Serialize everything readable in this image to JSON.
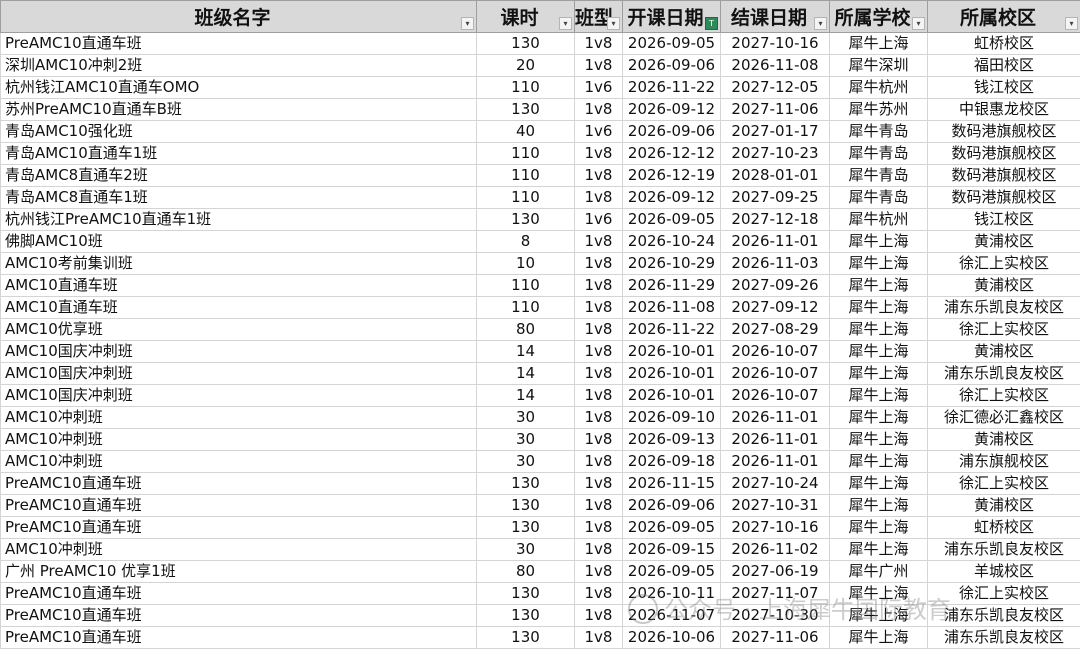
{
  "headers": [
    {
      "label": "班级名字",
      "filter_active": false
    },
    {
      "label": "课时",
      "filter_active": false
    },
    {
      "label": "班型",
      "filter_active": false
    },
    {
      "label": "开课日期",
      "filter_active": true
    },
    {
      "label": "结课日期",
      "filter_active": false
    },
    {
      "label": "所属学校",
      "filter_active": false
    },
    {
      "label": "所属校区",
      "filter_active": false
    }
  ],
  "filter_icons": {
    "inactive": "dropdown-arrow-icon",
    "active": "filter-funnel-icon"
  },
  "rows": [
    [
      "PreAMC10直通车班",
      "130",
      "1v8",
      "2026-09-05",
      "2027-10-16",
      "犀牛上海",
      "虹桥校区"
    ],
    [
      "深圳AMC10冲刺2班",
      "20",
      "1v8",
      "2026-09-06",
      "2026-11-08",
      "犀牛深圳",
      "福田校区"
    ],
    [
      "杭州钱江AMC10直通车OMO",
      "110",
      "1v6",
      "2026-11-22",
      "2027-12-05",
      "犀牛杭州",
      "钱江校区"
    ],
    [
      "苏州PreAMC10直通车B班",
      "130",
      "1v8",
      "2026-09-12",
      "2027-11-06",
      "犀牛苏州",
      "中银惠龙校区"
    ],
    [
      "青岛AMC10强化班",
      "40",
      "1v6",
      "2026-09-06",
      "2027-01-17",
      "犀牛青岛",
      "数码港旗舰校区"
    ],
    [
      "青岛AMC10直通车1班",
      "110",
      "1v8",
      "2026-12-12",
      "2027-10-23",
      "犀牛青岛",
      "数码港旗舰校区"
    ],
    [
      "青岛AMC8直通车2班",
      "110",
      "1v8",
      "2026-12-19",
      "2028-01-01",
      "犀牛青岛",
      "数码港旗舰校区"
    ],
    [
      "青岛AMC8直通车1班",
      "110",
      "1v8",
      "2026-09-12",
      "2027-09-25",
      "犀牛青岛",
      "数码港旗舰校区"
    ],
    [
      "杭州钱江PreAMC10直通车1班",
      "130",
      "1v6",
      "2026-09-05",
      "2027-12-18",
      "犀牛杭州",
      "钱江校区"
    ],
    [
      "佛脚AMC10班",
      "8",
      "1v8",
      "2026-10-24",
      "2026-11-01",
      "犀牛上海",
      "黄浦校区"
    ],
    [
      "AMC10考前集训班",
      "10",
      "1v8",
      "2026-10-29",
      "2026-11-03",
      "犀牛上海",
      "徐汇上实校区"
    ],
    [
      "AMC10直通车班",
      "110",
      "1v8",
      "2026-11-29",
      "2027-09-26",
      "犀牛上海",
      "黄浦校区"
    ],
    [
      "AMC10直通车班",
      "110",
      "1v8",
      "2026-11-08",
      "2027-09-12",
      "犀牛上海",
      "浦东乐凯良友校区"
    ],
    [
      "AMC10优享班",
      "80",
      "1v8",
      "2026-11-22",
      "2027-08-29",
      "犀牛上海",
      "徐汇上实校区"
    ],
    [
      "AMC10国庆冲刺班",
      "14",
      "1v8",
      "2026-10-01",
      "2026-10-07",
      "犀牛上海",
      "黄浦校区"
    ],
    [
      "AMC10国庆冲刺班",
      "14",
      "1v8",
      "2026-10-01",
      "2026-10-07",
      "犀牛上海",
      "浦东乐凯良友校区"
    ],
    [
      "AMC10国庆冲刺班",
      "14",
      "1v8",
      "2026-10-01",
      "2026-10-07",
      "犀牛上海",
      "徐汇上实校区"
    ],
    [
      "AMC10冲刺班",
      "30",
      "1v8",
      "2026-09-10",
      "2026-11-01",
      "犀牛上海",
      "徐汇德必汇鑫校区"
    ],
    [
      "AMC10冲刺班",
      "30",
      "1v8",
      "2026-09-13",
      "2026-11-01",
      "犀牛上海",
      "黄浦校区"
    ],
    [
      "AMC10冲刺班",
      "30",
      "1v8",
      "2026-09-18",
      "2026-11-01",
      "犀牛上海",
      "浦东旗舰校区"
    ],
    [
      "PreAMC10直通车班",
      "130",
      "1v8",
      "2026-11-15",
      "2027-10-24",
      "犀牛上海",
      "徐汇上实校区"
    ],
    [
      "PreAMC10直通车班",
      "130",
      "1v8",
      "2026-09-06",
      "2027-10-31",
      "犀牛上海",
      "黄浦校区"
    ],
    [
      "PreAMC10直通车班",
      "130",
      "1v8",
      "2026-09-05",
      "2027-10-16",
      "犀牛上海",
      "虹桥校区"
    ],
    [
      "AMC10冲刺班",
      "30",
      "1v8",
      "2026-09-15",
      "2026-11-02",
      "犀牛上海",
      "浦东乐凯良友校区"
    ],
    [
      "广州 PreAMC10 优享1班",
      "80",
      "1v8",
      "2026-09-05",
      "2027-06-19",
      "犀牛广州",
      "羊城校区"
    ],
    [
      "PreAMC10直通车班",
      "130",
      "1v8",
      "2026-10-11",
      "2027-11-07",
      "犀牛上海",
      "徐汇上实校区"
    ],
    [
      "PreAMC10直通车班",
      "130",
      "1v8",
      "2026-11-07",
      "2027-10-30",
      "犀牛上海",
      "浦东乐凯良友校区"
    ],
    [
      "PreAMC10直通车班",
      "130",
      "1v8",
      "2026-10-06",
      "2027-11-06",
      "犀牛上海",
      "浦东乐凯良友校区"
    ]
  ],
  "watermark": {
    "text": "公众号 · 上海犀牛国际教育",
    "icon": "wechat-official-account-icon"
  }
}
